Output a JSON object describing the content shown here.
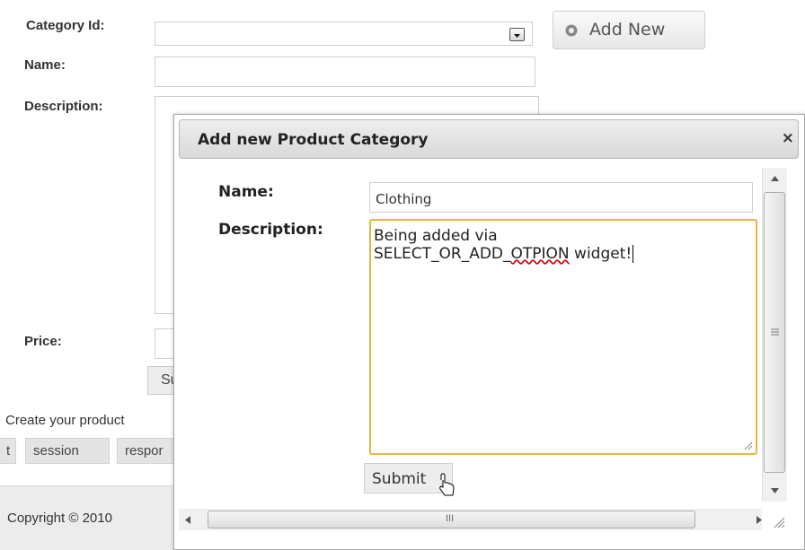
{
  "form": {
    "category_label": "Category Id:",
    "name_label": "Name:",
    "description_label": "Description:",
    "price_label": "Price:",
    "add_new_label": "Add New",
    "submit_partial": "Su",
    "create_text": "Create your product",
    "copyright": "Copyright © 2010"
  },
  "tags": [
    "t",
    "session",
    "respor"
  ],
  "dialog": {
    "title": "Add new Product Category",
    "close_symbol": "×",
    "name_label": "Name:",
    "name_value": "Clothing",
    "description_label": "Description:",
    "description_line1": "Being added via",
    "description_line2_pre": "SELECT_OR_ADD_",
    "description_line2_err": "OTPION",
    "description_line2_post": " widget!",
    "submit_label": "Submit",
    "hscroll_grip": "III"
  },
  "colors": {
    "focus_border": "#e8b447",
    "spell_error": "#d80000"
  }
}
